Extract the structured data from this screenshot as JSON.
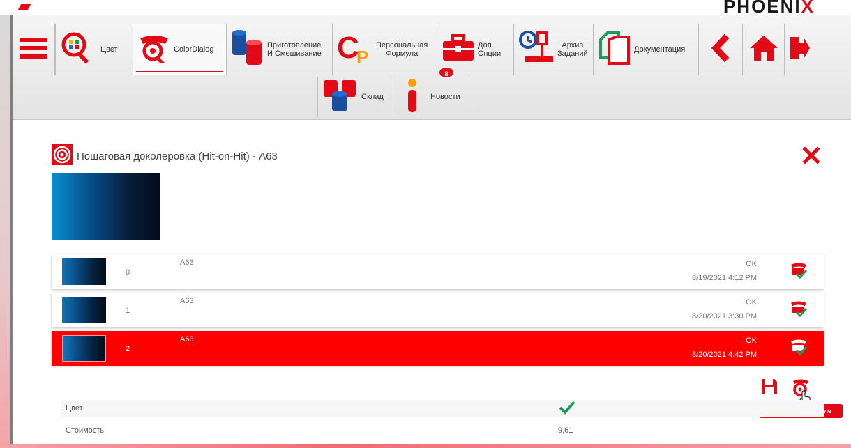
{
  "brand": {
    "text": "PHOENI",
    "x": "X"
  },
  "toolbar": {
    "items": [
      {
        "label": "Цвет"
      },
      {
        "label": "ColorDialog"
      },
      {
        "label": "Приготовление\nИ Смешивание"
      },
      {
        "label": "Персональная\nФормула"
      },
      {
        "label": "Доп.\nОпции",
        "badge": "8"
      },
      {
        "label": "Архив\nЗаданий"
      },
      {
        "label": "Документация"
      }
    ],
    "row2": [
      {
        "label": "Склад"
      },
      {
        "label": "Новости"
      }
    ]
  },
  "panel": {
    "title": "Пошаговая доколеровка (Hit-on-Hit) - A63",
    "hits": [
      {
        "index": "0",
        "name": "A63",
        "status": "OK",
        "date": "8/19/2021 4:12 PM"
      },
      {
        "index": "1",
        "name": "A63",
        "status": "OK",
        "date": "8/20/2021 3:30 PM"
      },
      {
        "index": "2",
        "name": "A63",
        "status": "OK",
        "date": "8/20/2021 4:42 PM"
      }
    ],
    "tooltip": "Перейти к формуле",
    "details": [
      {
        "key": "Цвет",
        "value": ""
      },
      {
        "key": "Стоимость",
        "value": "9,61"
      }
    ]
  },
  "colors": {
    "accent": "#e20a16",
    "selected_row": "#ff0000",
    "ok_green": "#1a9e5a"
  }
}
